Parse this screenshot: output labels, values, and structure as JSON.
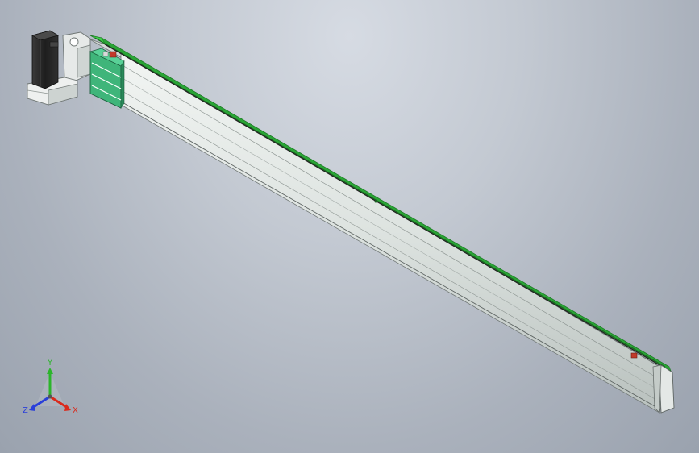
{
  "viewport": {
    "background_top": "#d6dbe3",
    "background_bottom": "#9aa2ae"
  },
  "model": {
    "parts": [
      "stepper-motor",
      "motor-mount-bracket",
      "coupling-housing",
      "carriage-block",
      "aluminum-profile-beam",
      "linear-guide-rail",
      "end-cap",
      "limit-sensor"
    ],
    "colors": {
      "rail_green": "#3fd24a",
      "beam_light": "#e6ebe8",
      "beam_mid": "#c9d0cd",
      "beam_shadow": "#8e9693",
      "motor_black": "#262626",
      "sensor_red": "#c23a2a"
    }
  },
  "triad": {
    "x_label": "X",
    "y_label": "Y",
    "z_label": "Z",
    "x_color": "#d92a1c",
    "y_color": "#2bb52b",
    "z_color": "#2a3fd9"
  }
}
